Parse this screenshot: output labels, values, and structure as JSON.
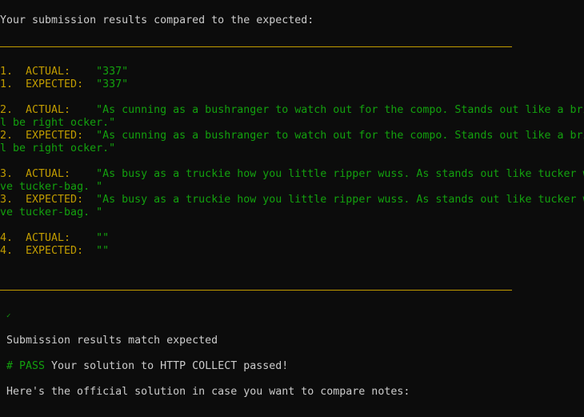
{
  "header": "Your submission results compared to the expected:",
  "results": [
    {
      "actual_prefix": "1.  ACTUAL:    ",
      "actual_value": "\"337\"",
      "expected_prefix": "1.  EXPECTED:  ",
      "expected_value": "\"337\""
    },
    {
      "actual_prefix": "2.  ACTUAL:    ",
      "actual_value": "\"As cunning as a bushranger to watch out for the compo. Stands out like a bri",
      "actual_wrap": "l be right ocker.\"",
      "expected_prefix": "2.  EXPECTED:  ",
      "expected_value": "\"As cunning as a bushranger to watch out for the compo. Stands out like a bri",
      "expected_wrap": "l be right ocker.\""
    },
    {
      "actual_prefix": "3.  ACTUAL:    ",
      "actual_value": "\"As busy as a truckie how you little ripper wuss. As stands out like tucker w",
      "actual_wrap": "ve tucker-bag. \"",
      "expected_prefix": "3.  EXPECTED:  ",
      "expected_value": "\"As busy as a truckie how you little ripper wuss. As stands out like tucker w",
      "expected_wrap": "ve tucker-bag. \""
    },
    {
      "actual_prefix": "4.  ACTUAL:    ",
      "actual_value": "\"\"",
      "expected_prefix": "4.  EXPECTED:  ",
      "expected_value": "\"\""
    }
  ],
  "check_glyph": "✓",
  "match_message": "Submission results match expected",
  "pass_marker": "# PASS",
  "pass_message": " Your solution to HTTP COLLECT passed!",
  "solution_message": "Here's the official solution in case you want to compare notes:",
  "colors": {
    "background": "#0c0c0c",
    "text": "#cccccc",
    "label": "#c19c00",
    "value": "#13a10e",
    "separator": "#c19c00"
  }
}
